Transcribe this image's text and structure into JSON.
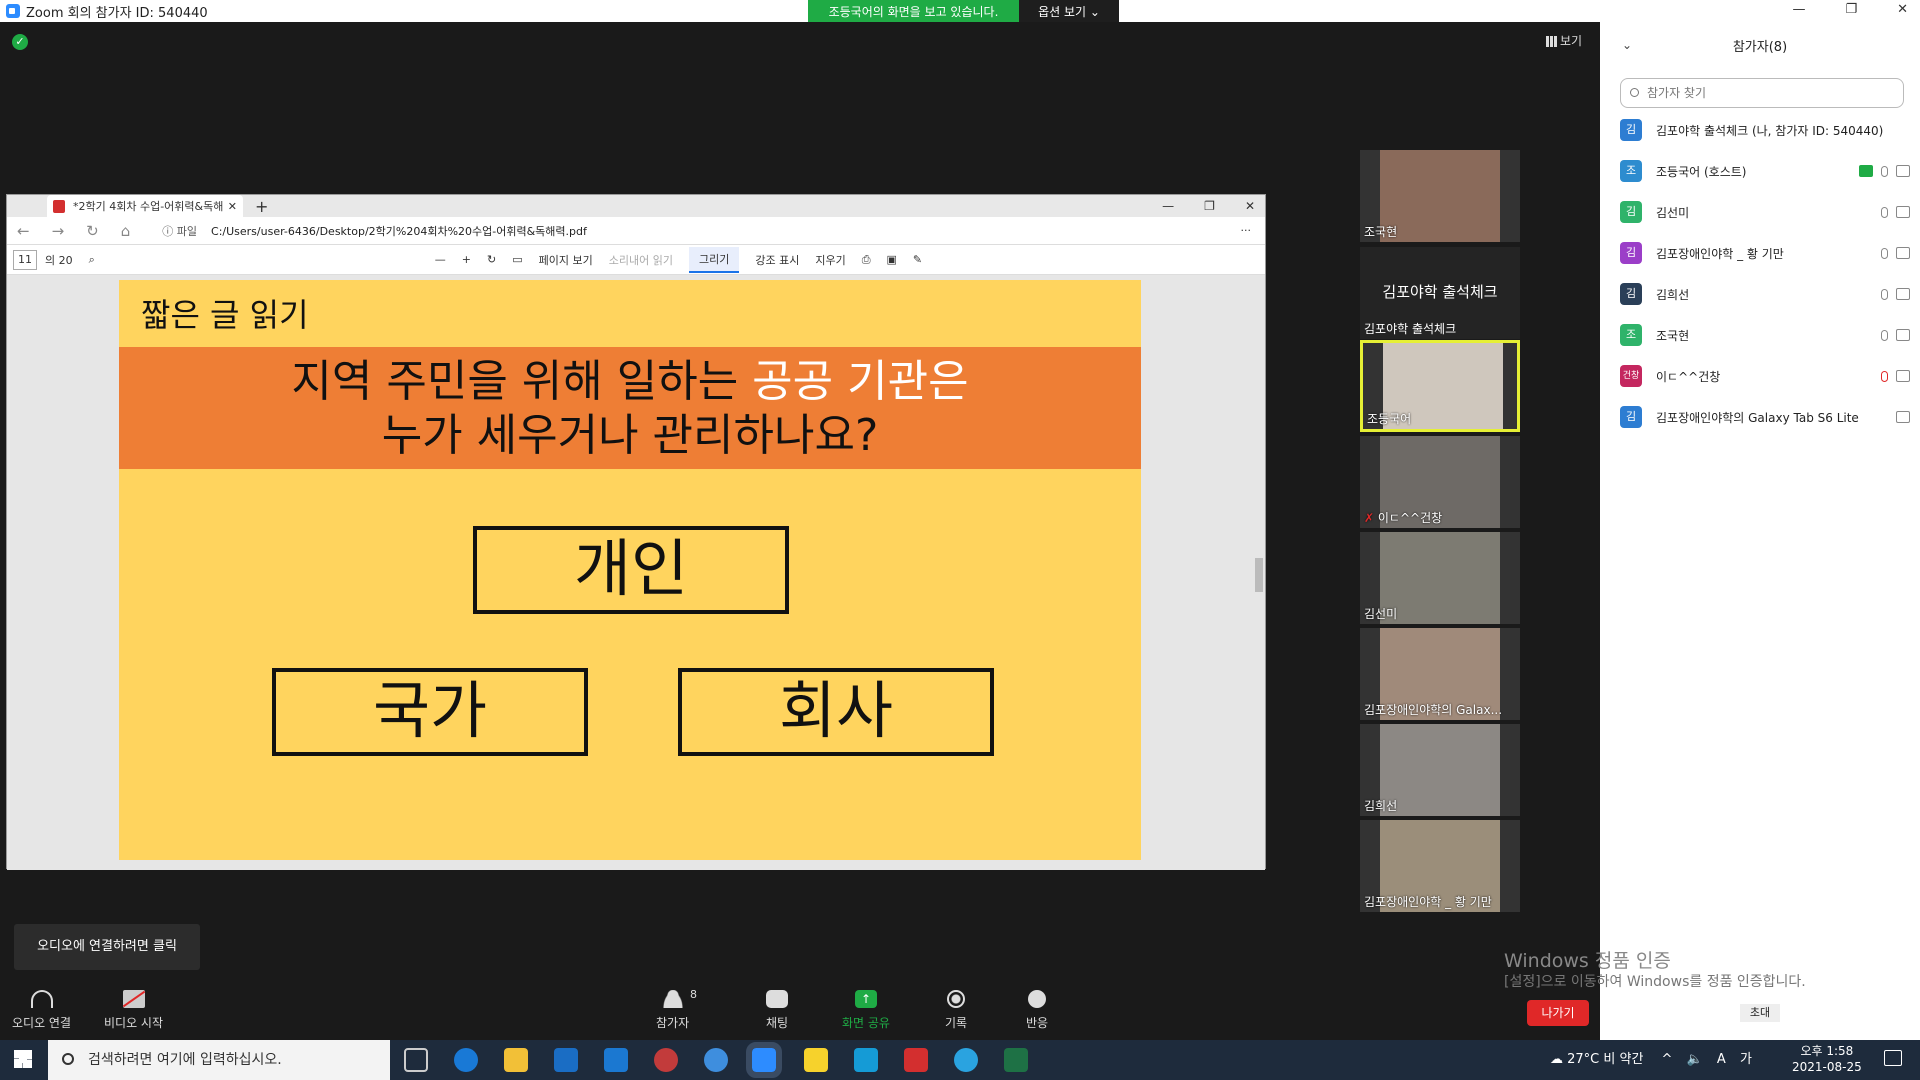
{
  "window": {
    "title": "Zoom 회의 참가자 ID: 540440"
  },
  "share_banner": {
    "text": "조등국어의 화면을 보고 있습니다.",
    "view_options": "옵션 보기 ⌄"
  },
  "view_button": "보기",
  "browser": {
    "tab_title": "*2학기 4회차 수업-어휘력&독해",
    "url_prefix": "ⓘ 파일",
    "url": "C:/Users/user-6436/Desktop/2학기%204회차%20수업-어휘력&독해력.pdf",
    "page_current": "11",
    "page_total": "의 20",
    "tools": {
      "page_view": "페이지 보기",
      "read_aloud": "소리내어 읽기",
      "draw": "그리기",
      "highlight": "강조 표시",
      "erase": "지우기"
    }
  },
  "slide": {
    "header": "짧은 글 읽기",
    "question_line1_a": "지역 주민을 위해 일하는 ",
    "question_line1_b": "공공 기관은",
    "question_line2": "누가 세우거나 관리하나요?",
    "options": [
      "개인",
      "국가",
      "회사"
    ]
  },
  "videos": [
    {
      "name": "조국현",
      "color": "#8a6a5a"
    },
    {
      "name": "조등국어",
      "color": "#cfc7bd"
    },
    {
      "name": "이ㄷ^^건창",
      "color": "#6e6a66"
    },
    {
      "name": "김선미",
      "color": "#7d7b72"
    },
    {
      "name": "김포장애인야학의 Galax...",
      "color": "#a08a7a"
    },
    {
      "name": "김희선",
      "color": "#8c8884"
    },
    {
      "name": "김포장애인야학 _ 황 기만",
      "color": "#9b8e7a"
    }
  ],
  "name_tile": {
    "big": "김포야학 출석체크",
    "label": "김포야학 출석체크"
  },
  "panel": {
    "title": "참가자(8)",
    "search_placeholder": "참가자 찾기",
    "participants": [
      {
        "avatar": "김",
        "color": "#2d7dd2",
        "name": "김포야학 출석체크 (나, 참가자 ID: 540440)"
      },
      {
        "avatar": "조",
        "color": "#2d8ccf",
        "name": "조등국어 (호스트)"
      },
      {
        "avatar": "김",
        "color": "#2fb36a",
        "name": "김선미"
      },
      {
        "avatar": "김",
        "color": "#9b3ec8",
        "name": "김포장애인야학 _ 황 기만"
      },
      {
        "avatar": "김",
        "color": "#2a3f58",
        "name": "김희선"
      },
      {
        "avatar": "조",
        "color": "#2fb36a",
        "name": "조국현"
      },
      {
        "avatar": "건창",
        "color": "#c4275f",
        "name": "이ㄷ^^건창"
      },
      {
        "avatar": "김",
        "color": "#2d7dd2",
        "name": "김포장애인야학의 Galaxy Tab S6 Lite"
      }
    ],
    "invite": "초대"
  },
  "watermark": {
    "line1": "Windows 정품 인증",
    "line2": "[설정]으로 이동하여 Windows를 정품 인증합니다."
  },
  "toolbar": {
    "audio_tip": "오디오에 연결하려면 클릭",
    "audio": "오디오 연결",
    "video": "비디오 시작",
    "participants": "참가자",
    "participants_count": "8",
    "chat": "채팅",
    "share": "화면 공유",
    "record": "기록",
    "reactions": "반응",
    "leave": "나가기"
  },
  "taskbar": {
    "search": "검색하려면 여기에 입력하십시오.",
    "weather": "27°C  비 약간",
    "time": "오후 1:58",
    "date": "2021-08-25"
  }
}
